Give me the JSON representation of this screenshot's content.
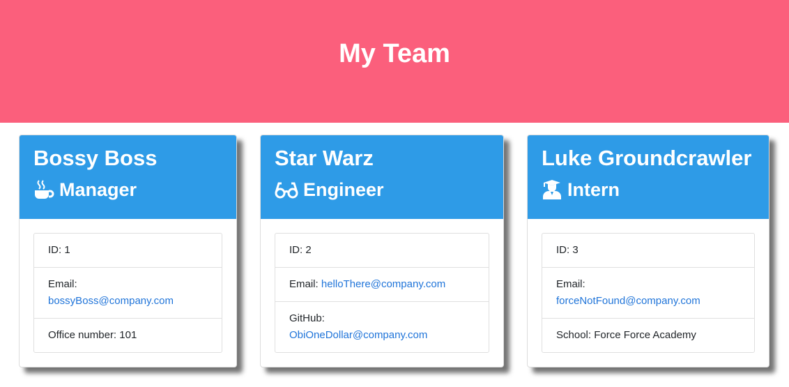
{
  "page_title": "My Team",
  "colors": {
    "header_bg": "#fb5f7c",
    "card_head_bg": "#2e9be7",
    "link": "#1f74d9"
  },
  "employees": [
    {
      "name": "Bossy Boss",
      "role": "Manager",
      "role_icon": "mug-hot-icon",
      "id_label": "ID: 1",
      "email_label": "Email:",
      "email": "bossyBoss@company.com",
      "extra": "Office number: 101"
    },
    {
      "name": "Star Warz",
      "role": "Engineer",
      "role_icon": "glasses-icon",
      "id_label": "ID: 2",
      "email_label": "Email:",
      "email": "helloThere@company.com",
      "extra_label": "GitHub:",
      "extra_link": "ObiOneDollar@company.com"
    },
    {
      "name": "Luke Groundcrawler",
      "role": "Intern",
      "role_icon": "user-graduate-icon",
      "id_label": "ID: 3",
      "email_label": "Email:",
      "email": "forceNotFound@company.com",
      "extra": "School: Force Force Academy"
    }
  ]
}
